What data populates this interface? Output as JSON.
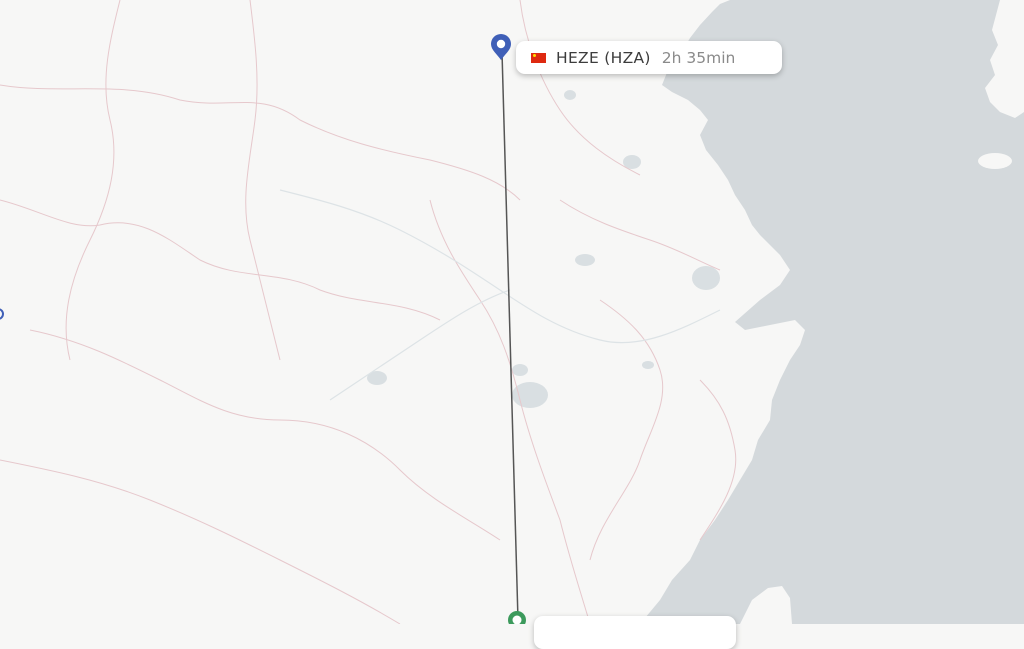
{
  "map": {
    "colors": {
      "land": "#f7f7f6",
      "sea": "#d4d9dc",
      "lake": "#d9dfe2",
      "province_border": "#e6c8cc",
      "route_line": "#555555",
      "destination_pin": "#3f5fb7",
      "origin_pin": "#3c9a5c"
    }
  },
  "destination": {
    "flag_icon": "china-flag-icon",
    "name": "HEZE (HZA)",
    "duration": "2h 35min"
  },
  "origin": {
    "pin_icon": "origin-circle-pin-icon"
  }
}
